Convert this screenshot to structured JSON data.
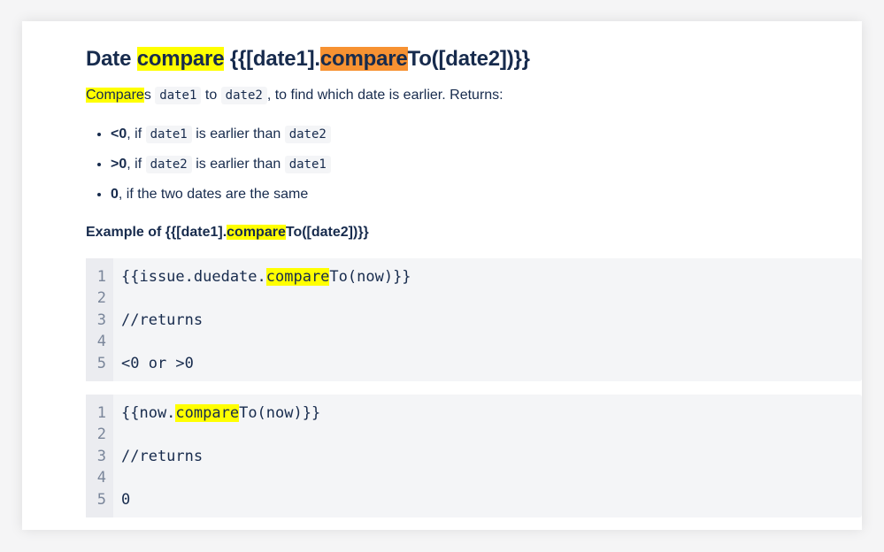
{
  "heading": {
    "pre": "Date ",
    "hl1": "compare",
    "mid": " {{[date1].",
    "hl2": "compare",
    "post": "To([date2])}}"
  },
  "intro": {
    "hl": "Compare",
    "t1": "s ",
    "code1": "date1",
    "t2": " to ",
    "code2": "date2",
    "t3": ", to find which date is earlier. Returns:"
  },
  "bullets": [
    {
      "bold": "<0",
      "t1": ", if ",
      "code1": "date1",
      "t2": " is earlier than ",
      "code2": "date2"
    },
    {
      "bold": ">0",
      "t1": ", if ",
      "code1": "date2",
      "t2": " is earlier than ",
      "code2": "date1"
    },
    {
      "bold": "0",
      "t1": ", if the two dates are the same"
    }
  ],
  "example_heading": {
    "pre": "Example of {{[date1].",
    "hl": "compare",
    "post": "To([date2])}}"
  },
  "code_blocks": [
    {
      "line_numbers": [
        "1",
        "2",
        "3",
        "4",
        "5"
      ],
      "line1_pre": "{{issue.duedate.",
      "line1_hl": "compare",
      "line1_post": "To(now)}}",
      "line3": "//returns",
      "line5": "<0 or >0"
    },
    {
      "line_numbers": [
        "1",
        "2",
        "3",
        "4",
        "5"
      ],
      "line1_pre": "{{now.",
      "line1_hl": "compare",
      "line1_post": "To(now)}}",
      "line3": "//returns",
      "line5": "0"
    }
  ],
  "colors": {
    "highlight_yellow": "#ffff00",
    "highlight_orange": "#f79232",
    "text": "#172b4d",
    "code_bg": "#f4f5f7",
    "gutter_bg": "#ebecf0"
  }
}
